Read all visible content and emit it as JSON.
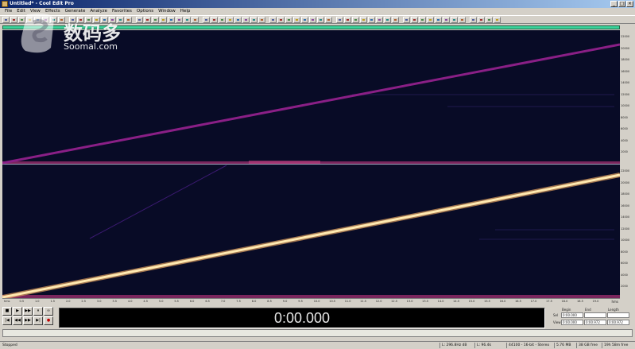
{
  "window": {
    "title": "Untitled* - Cool Edit Pro",
    "buttons": [
      "_",
      "□",
      "×"
    ]
  },
  "menu": [
    "File",
    "Edit",
    "View",
    "Effects",
    "Generate",
    "Analyze",
    "Favorites",
    "Options",
    "Window",
    "Help"
  ],
  "watermark": {
    "text": "数码多",
    "sub": "Soomal.com"
  },
  "freq_ruler": [
    "22000",
    "20000",
    "18000",
    "16000",
    "14000",
    "12000",
    "10000",
    "8000",
    "6000",
    "4000",
    "2000"
  ],
  "time_ruler": {
    "ticks": [
      "hms",
      "0.5",
      "1.0",
      "1.5",
      "2.0",
      "2.5",
      "3.0",
      "3.5",
      "4.0",
      "4.5",
      "5.0",
      "5.5",
      "6.0",
      "6.5",
      "7.0",
      "7.5",
      "8.0",
      "8.5",
      "9.0",
      "9.5",
      "10.0",
      "10.5",
      "11.0",
      "11.5",
      "12.0",
      "12.5",
      "13.0",
      "13.5",
      "14.0",
      "14.5",
      "15.0",
      "15.5",
      "16.0",
      "16.5",
      "17.0",
      "17.5",
      "18.0",
      "18.5",
      "19.0"
    ],
    "unit": "hms"
  },
  "transport": {
    "row1": [
      "■",
      "▶",
      "▶▶",
      "⏸",
      "∞"
    ],
    "row2": [
      "|◀",
      "◀◀",
      "▶▶",
      "▶|",
      "●"
    ]
  },
  "time_display": "0:00.000",
  "selection_view": {
    "headers": [
      "Begin",
      "End",
      "Length"
    ],
    "rows": [
      {
        "label": "Sel",
        "values": [
          "0:00.000",
          "",
          ""
        ]
      },
      {
        "label": "View",
        "values": [
          "0:00.000",
          "0:00.972",
          "0:00.972"
        ]
      }
    ]
  },
  "status": {
    "state": "Stopped",
    "fields": [
      "L: 296.8Hz dB",
      "L: 96.4k",
      "44100 - 16-bit - Stereo",
      "5.76 MB",
      "38 GB free",
      "19h 58m free"
    ]
  }
}
